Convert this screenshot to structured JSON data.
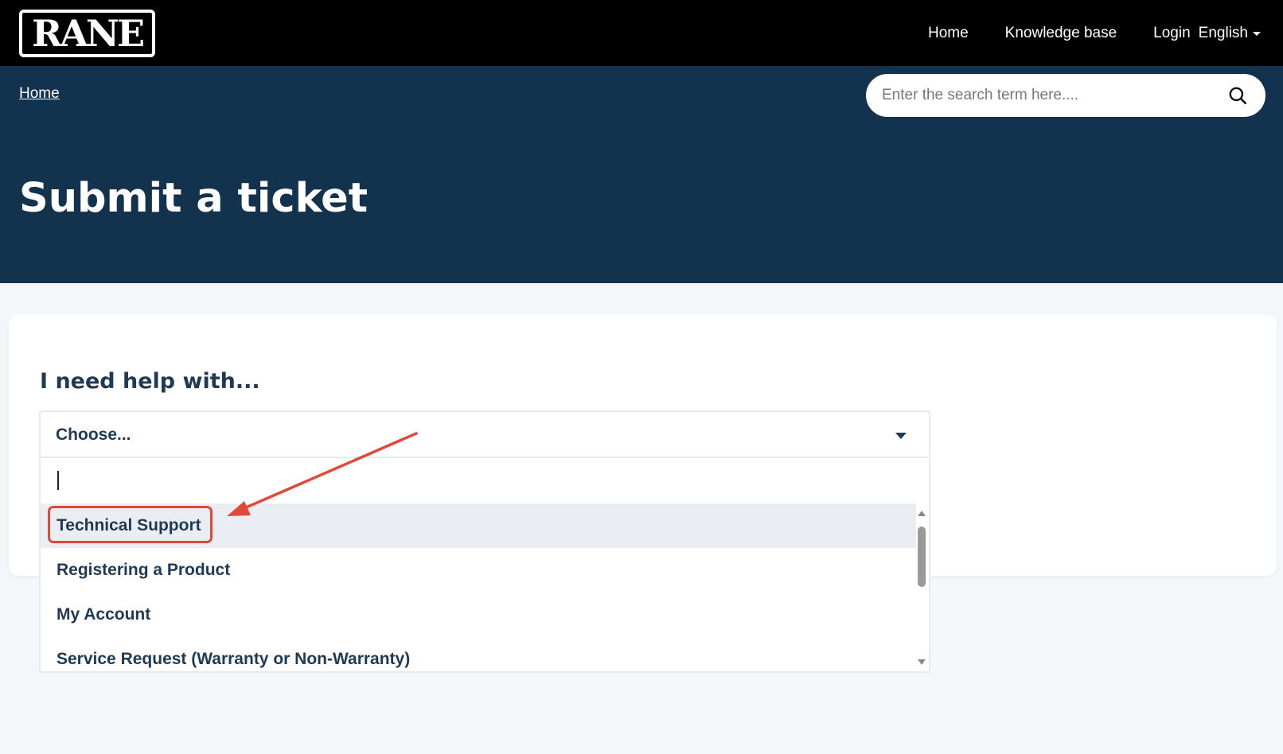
{
  "header": {
    "logo_text": "RANE",
    "nav": {
      "home": "Home",
      "knowledge_base": "Knowledge base",
      "login": "Login",
      "language": "English"
    }
  },
  "hero": {
    "breadcrumb": "Home",
    "search_placeholder": "Enter the search term here....",
    "title": "Submit a ticket"
  },
  "form": {
    "help_label": "I need help with...",
    "select_value": "Choose...",
    "dropdown_search_value": "",
    "options": [
      "Technical Support",
      "Registering a Product",
      "My Account",
      "Service Request (Warranty or Non-Warranty)"
    ],
    "active_option_index": 0
  },
  "annotation": {
    "color": "#e0483a"
  },
  "colors": {
    "topbar": "#000000",
    "hero": "#13324e",
    "text_dark": "#1f3a55",
    "page_bg": "#f4f6f9"
  }
}
